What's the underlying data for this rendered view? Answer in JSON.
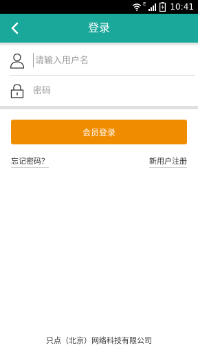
{
  "status_bar": {
    "time": "10:41",
    "network_label": "E",
    "icons": [
      "wifi-icon",
      "signal-icon",
      "battery-icon"
    ]
  },
  "header": {
    "title": "登录",
    "back_icon": "chevron-left-icon",
    "background": "#1aa89a"
  },
  "form": {
    "username": {
      "placeholder": "请输入用户名",
      "value": "",
      "icon": "user-icon"
    },
    "password": {
      "placeholder": "密码",
      "value": "",
      "icon": "lock-icon"
    }
  },
  "login_button": {
    "label": "会员登录",
    "color": "#f08c00"
  },
  "links": {
    "forgot_password": "忘记密码？",
    "register": "新用户注册"
  },
  "footer": {
    "company": "只点（北京）网络科技有限公司"
  }
}
